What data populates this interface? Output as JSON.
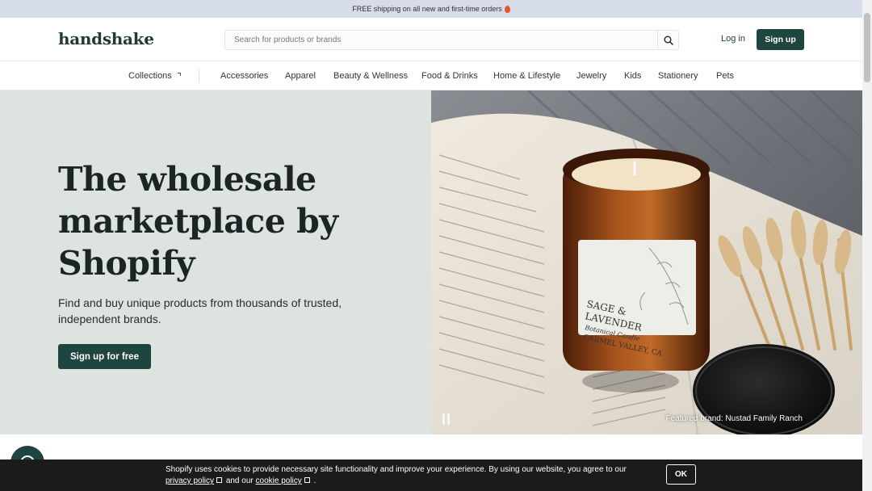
{
  "announcement": {
    "text": "FREE shipping on all new and first-time orders"
  },
  "header": {
    "logo": "handshake",
    "search_placeholder": "Search for products or brands",
    "login_label": "Log in",
    "signup_label": "Sign up"
  },
  "nav": {
    "collections_label": "Collections",
    "items": [
      "Accessories",
      "Apparel",
      "Beauty & Wellness",
      "Food & Drinks",
      "Home & Lifestyle",
      "Jewelry",
      "Kids",
      "Stationery",
      "Pets"
    ]
  },
  "hero": {
    "title": "The wholesale marketplace by Shopify",
    "subtitle": "Find and buy unique products from thousands of trusted, independent brands.",
    "cta_label": "Sign up for free",
    "caption": "Featured brand: Nustad Family Ranch",
    "candle_label_line1": "SAGE &",
    "candle_label_line2": "LAVENDER",
    "candle_label_line3": "Botanical Candle",
    "candle_label_line4": "CARMEL VALLEY, CA"
  },
  "cookie": {
    "text": "Shopify uses cookies to provide necessary site functionality and improve your experience. By using our website, you agree to our",
    "privacy_label": "privacy policy",
    "and_text": "and our",
    "cookie_label": "cookie policy",
    "end_text": ".",
    "ok_label": "OK"
  },
  "colors": {
    "brand": "#1e4540",
    "announcement_bg": "#d6dcea",
    "hero_bg": "#dde3df",
    "cookie_bg": "#1b1b1b"
  }
}
